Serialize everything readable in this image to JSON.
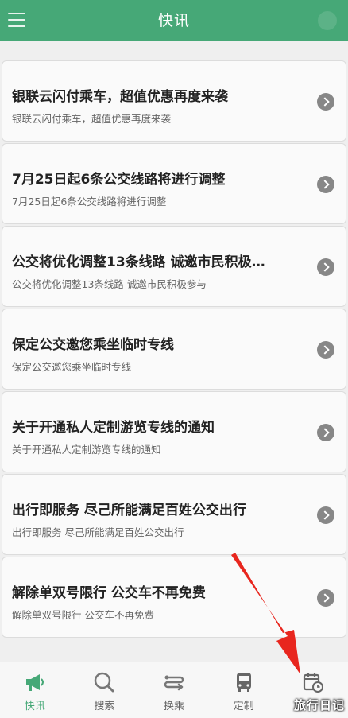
{
  "header": {
    "title": "快讯"
  },
  "news": [
    {
      "title": "银联云闪付乘车，超值优惠再度来袭",
      "subtitle": "银联云闪付乘车，超值优惠再度来袭"
    },
    {
      "title": "7月25日起6条公交线路将进行调整",
      "subtitle": "7月25日起6条公交线路将进行调整"
    },
    {
      "title": "公交将优化调整13条线路 诚邀市民积极…",
      "subtitle": "公交将优化调整13条线路 诚邀市民积极参与"
    },
    {
      "title": "保定公交邀您乘坐临时专线",
      "subtitle": "保定公交邀您乘坐临时专线"
    },
    {
      "title": "关于开通私人定制游览专线的通知",
      "subtitle": "关于开通私人定制游览专线的通知"
    },
    {
      "title": "出行即服务 尽己所能满足百姓公交出行",
      "subtitle": "出行即服务 尽己所能满足百姓公交出行"
    },
    {
      "title": "解除单双号限行 公交车不再免费",
      "subtitle": "解除单双号限行 公交车不再免费"
    }
  ],
  "tabs": [
    {
      "label": "快讯",
      "icon": "megaphone-icon",
      "active": true
    },
    {
      "label": "搜索",
      "icon": "search-icon",
      "active": false
    },
    {
      "label": "换乘",
      "icon": "transfer-icon",
      "active": false
    },
    {
      "label": "定制",
      "icon": "bus-icon",
      "active": false
    },
    {
      "label": "",
      "icon": "calendar-clock-icon",
      "active": false
    }
  ],
  "watermark": "旅行日记",
  "colors": {
    "accent": "#46a877",
    "arrow": "#e8261e"
  }
}
